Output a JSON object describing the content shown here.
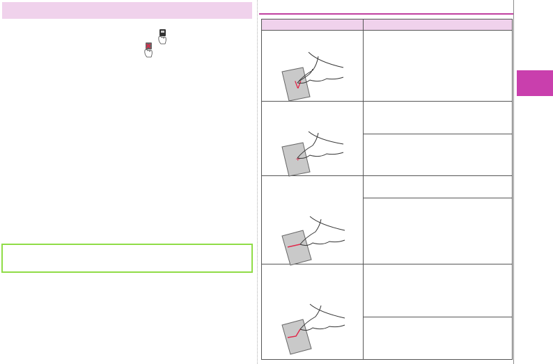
{
  "left_column": {
    "header_text": "",
    "body_text": "",
    "note_text": ""
  },
  "right_column": {
    "section_title": "",
    "table": {
      "headers": [
        "",
        ""
      ],
      "groups": [
        {
          "mark_label": "V",
          "descriptions": [
            ""
          ]
        },
        {
          "mark_label": "",
          "descriptions": [
            "",
            ""
          ]
        },
        {
          "mark_label": "",
          "descriptions": [
            "",
            ""
          ]
        },
        {
          "mark_label": "",
          "descriptions": [
            "",
            ""
          ]
        }
      ]
    }
  },
  "colors": {
    "header_pink": "#f0d2ec",
    "section_rule": "#c040a0",
    "note_border": "#8fdc46",
    "tab_marker": "#c93fad",
    "stroke_red": "#e0284a"
  },
  "icons": [
    "phone-hand-icon",
    "phone-mute-hand-icon",
    "hand-card-illustration"
  ]
}
